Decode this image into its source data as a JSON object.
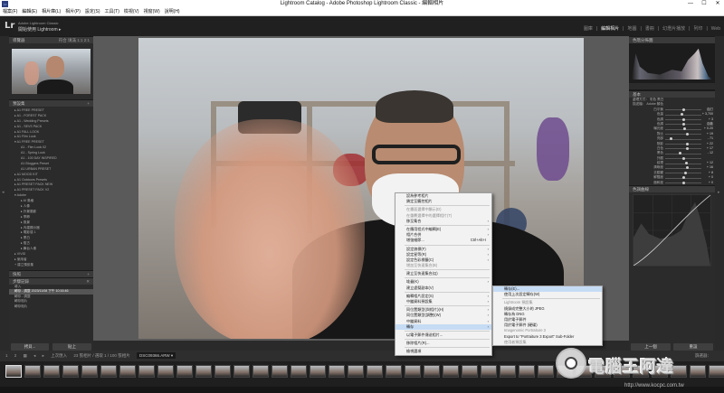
{
  "titlebar": {
    "title": "Lightroom Catalog - Adobe Photoshop Lightroom Classic - 編輯相片",
    "app_icon": "Lr",
    "minimize": "—",
    "maximize": "☐",
    "close": "✕"
  },
  "menubar": [
    "檔案(F)",
    "編輯(E)",
    "相片庫(L)",
    "相片(P)",
    "設定(S)",
    "工具(T)",
    "檢視(V)",
    "視窗(W)",
    "說明(H)"
  ],
  "identity": {
    "logo": "Lr",
    "line1": "Adobe Lightroom Classic",
    "line2": "開始使用 Lightroom ▸"
  },
  "modules": [
    "圖庫",
    "編輯相片",
    "地圖",
    "書冊",
    "幻燈片播放",
    "列印",
    "Web"
  ],
  "active_module": "編輯相片",
  "left_panel": {
    "navigator_label": "導覽器",
    "navigator_zoom": "符合  填滿  1:1  2:1",
    "presets_label": "預設集",
    "presets": [
      {
        "label": "▸ A1 FREE PRESET",
        "level": 0
      },
      {
        "label": "▸ A1 - FOREST PACK",
        "level": 0
      },
      {
        "label": "▸ A1 - Wedding Presets",
        "level": 0
      },
      {
        "label": "▸ A1 - SEVS PACK",
        "level": 0
      },
      {
        "label": "▸ A1 FALL LOOK",
        "level": 0
      },
      {
        "label": "▸ A1 Film Look",
        "level": 0
      },
      {
        "label": "▾ A1 FREE PRESET",
        "level": 0
      },
      {
        "label": "A1 - Film Look 02",
        "level": 1
      },
      {
        "label": "A1 - Spring Look",
        "level": 1
      },
      {
        "label": "A1 - 100 DAY INSPIRED",
        "level": 1
      },
      {
        "label": "A1 Bloggers Preset",
        "level": 1
      },
      {
        "label": "A1 URBAN PRESET",
        "level": 1
      },
      {
        "label": "▸ A1 MOOD KIT",
        "level": 0
      },
      {
        "label": "▸ A1 Outdoors Presets",
        "level": 0
      },
      {
        "label": "▸ A1 PRESET PACK NEW",
        "level": 0
      },
      {
        "label": "▸ A1 PRESET PACK V2",
        "level": 0
      },
      {
        "label": "▾ Adobe",
        "level": 0
      },
      {
        "label": "▸ AI 風格",
        "level": 1
      },
      {
        "label": "▸ 人像",
        "level": 1
      },
      {
        "label": "▸ 外景攝影",
        "level": 1
      },
      {
        "label": "▸ 季節",
        "level": 1
      },
      {
        "label": "▸ 風景",
        "level": 1
      },
      {
        "label": "▸ 內建顯示器",
        "level": 1
      },
      {
        "label": "▸ 電影感 1",
        "level": 1
      },
      {
        "label": "▸ 黑白",
        "level": 1
      },
      {
        "label": "▸ 復古",
        "level": 1
      },
      {
        "label": "▸ 舞台人像",
        "level": 1
      },
      {
        "label": "▸ VIVID",
        "level": 0
      },
      {
        "label": "▸ 使用者",
        "level": 0
      },
      {
        "label": "+ 建立預設集",
        "level": 0
      }
    ],
    "snapshots_label": "快照",
    "history_label": "步驟記錄",
    "history": [
      {
        "label": "導入",
        "sel": false
      },
      {
        "label": "轉存 - 調整 2023/11/08 下午 10:16:46",
        "sel": true
      },
      {
        "label": "轉存 - 調整",
        "sel": false
      },
      {
        "label": "轉存相片",
        "sel": false
      },
      {
        "label": "轉存相片",
        "sel": false
      }
    ],
    "copy_button": "拷貝...",
    "paste_button": "貼上"
  },
  "right_panel": {
    "histogram_label": "色階分佈圖",
    "basic_label": "基本",
    "treatment": "處理方式：  彩色  黑白",
    "profile": "描述檔：  Adobe 顏色",
    "sliders": [
      {
        "label": "白平衡",
        "value": "自訂",
        "pos": 0.5
      },
      {
        "label": "色溫",
        "value": "+ 3,700",
        "pos": 0.45
      },
      {
        "label": "色調",
        "value": "+ 3",
        "pos": 0.52
      },
      {
        "label": "色調",
        "value": "自動",
        "pos": 0.5
      },
      {
        "label": "曝光度",
        "value": "+ 0.20",
        "pos": 0.54
      },
      {
        "label": "對比",
        "value": "+ 19",
        "pos": 0.6
      },
      {
        "label": "亮部",
        "value": "- 71",
        "pos": 0.15
      },
      {
        "label": "陰影",
        "value": "+ 22",
        "pos": 0.62
      },
      {
        "label": "白色",
        "value": "+ 17",
        "pos": 0.6
      },
      {
        "label": "黑色",
        "value": "- 12",
        "pos": 0.42
      },
      {
        "label": "外觀",
        "value": "",
        "pos": 0.5
      },
      {
        "label": "紋理",
        "value": "+ 12",
        "pos": 0.58
      },
      {
        "label": "清晰度",
        "value": "+ 16",
        "pos": 0.6
      },
      {
        "label": "去朦朧",
        "value": "+ 8",
        "pos": 0.55
      },
      {
        "label": "鮮豔度",
        "value": "+ 0",
        "pos": 0.5
      },
      {
        "label": "飽和度",
        "value": "+ 0",
        "pos": 0.5
      }
    ],
    "tone_curve_label": "色調曲線",
    "prev_button": "上一個",
    "reset_button": "重設"
  },
  "filmstrip": {
    "items": [
      "1",
      "2"
    ],
    "source": "上次匯入",
    "count": "23 張相片 / 選取 1 / 100 張相片",
    "filename": "DSC09366.ARW ▾",
    "filter_label": "篩選器："
  },
  "context_menu": {
    "items": [
      {
        "label": "設為參考相片",
        "type": "item"
      },
      {
        "label": "鎖定至觸控相片",
        "type": "item"
      },
      {
        "label": "sep",
        "type": "sep"
      },
      {
        "label": "在畫面選擇中顯示(D)",
        "type": "dis"
      },
      {
        "label": "在重覆選擇中的選擇相片(T)",
        "type": "dis"
      },
      {
        "label": "移至集合",
        "type": "sub"
      },
      {
        "label": "sep",
        "type": "sep"
      },
      {
        "label": "在應用程式中編輯(E)",
        "type": "sub"
      },
      {
        "label": "相片合併",
        "type": "sub"
      },
      {
        "label": "增強細節...",
        "shortcut": "Ctrl+Alt+I",
        "type": "item"
      },
      {
        "label": "sep",
        "type": "sep"
      },
      {
        "label": "設定旗標(F)",
        "type": "sub"
      },
      {
        "label": "設定星等(R)",
        "type": "sub"
      },
      {
        "label": "設定色彩標籤(C)",
        "type": "sub"
      },
      {
        "label": "增加至快速集合(B)",
        "type": "dis"
      },
      {
        "label": "sep",
        "type": "sep"
      },
      {
        "label": "建立至快速集合(Q)",
        "type": "item"
      },
      {
        "label": "sep",
        "type": "sep"
      },
      {
        "label": "堆疊(K)",
        "type": "sub"
      },
      {
        "label": "建立虛擬副本(V)",
        "type": "item"
      },
      {
        "label": "sep",
        "type": "sep"
      },
      {
        "label": "編輯相片設定(S)",
        "type": "sub"
      },
      {
        "label": "中繼資料預設集",
        "type": "sub"
      },
      {
        "label": "sep",
        "type": "sep"
      },
      {
        "label": "同位置類型(與相片)(H)",
        "type": "sub"
      },
      {
        "label": "同位置類型(調整)(W)",
        "type": "sub"
      },
      {
        "label": "中繼資料",
        "type": "sub"
      },
      {
        "label": "轉存",
        "type": "hl-sub"
      },
      {
        "label": "sep",
        "type": "sep"
      },
      {
        "label": "以電子郵件傳送相片...",
        "type": "item"
      },
      {
        "label": "sep",
        "type": "sep"
      },
      {
        "label": "移除相片(R)...",
        "type": "item"
      },
      {
        "label": "sep",
        "type": "sep"
      },
      {
        "label": "檢視選項",
        "type": "item"
      }
    ]
  },
  "export_submenu": {
    "items": [
      {
        "label": "轉存(E)...",
        "type": "hl"
      },
      {
        "label": "使用上次設定轉存(W)",
        "type": "item"
      },
      {
        "label": "sep",
        "type": "sep"
      },
      {
        "label": "Lightroom 預設集",
        "type": "head"
      },
      {
        "label": "燒錄成完整大小的 JPEG",
        "type": "item"
      },
      {
        "label": "轉存為 DNG",
        "type": "item"
      },
      {
        "label": "用於電子郵件",
        "type": "item"
      },
      {
        "label": "用於電子郵件 (硬碟)",
        "type": "item"
      },
      {
        "label": "Imagenomic Portraiture 3",
        "type": "head"
      },
      {
        "label": "Export to \"Portraiture 3 Export\" Sub-Folder",
        "type": "item"
      },
      {
        "label": "使用者預設集",
        "type": "head"
      }
    ]
  },
  "watermark": {
    "text": "電腦王阿達",
    "url": "http://www.kocpc.com.tw"
  }
}
